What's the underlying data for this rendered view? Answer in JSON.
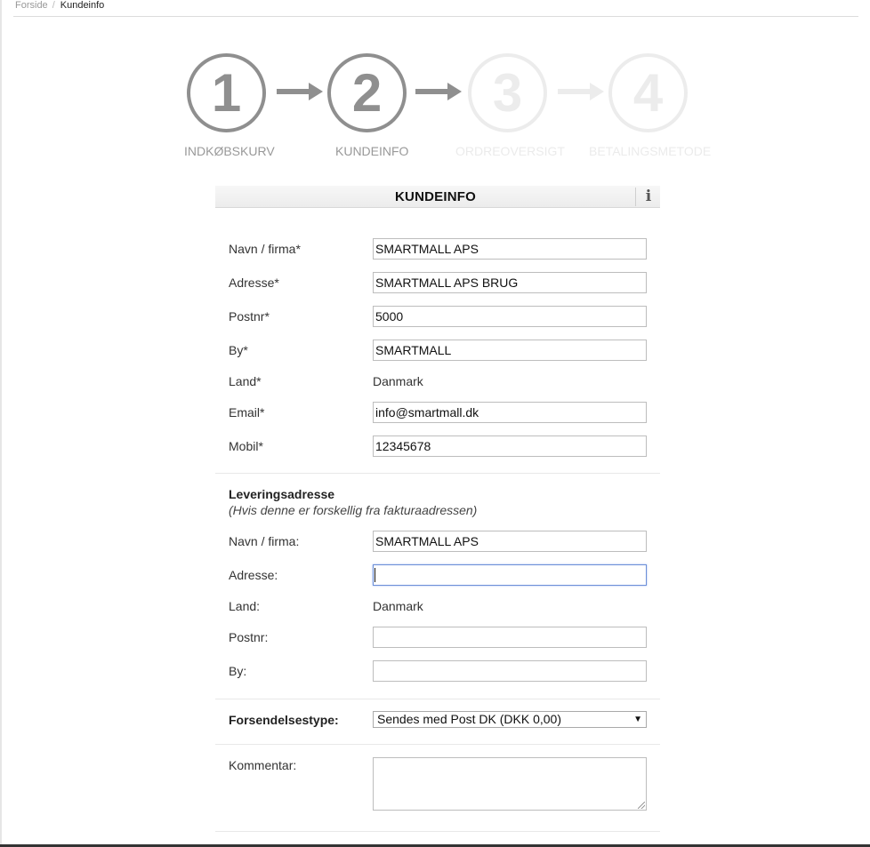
{
  "breadcrumb": {
    "home": "Forside",
    "separator": "/",
    "current": "Kundeinfo"
  },
  "steps": [
    {
      "number": "1",
      "label": "INDKØBSKURV",
      "state": "done"
    },
    {
      "number": "2",
      "label": "KUNDEINFO",
      "state": "active"
    },
    {
      "number": "3",
      "label": "ORDREOVERSIGT",
      "state": "inactive"
    },
    {
      "number": "4",
      "label": "BETALINGSMETODE",
      "state": "inactive"
    }
  ],
  "panel": {
    "title": "KUNDEINFO",
    "info_icon": "info-icon"
  },
  "customer": {
    "name_label": "Navn / firma*",
    "name_value": "SMARTMALL APS",
    "address_label": "Adresse*",
    "address_value": "SMARTMALL APS BRUG",
    "zip_label": "Postnr*",
    "zip_value": "5000",
    "city_label": "By*",
    "city_value": "SMARTMALL",
    "country_label": "Land*",
    "country_value": "Danmark",
    "email_label": "Email*",
    "email_value": "info@smartmall.dk",
    "mobile_label": "Mobil*",
    "mobile_value": "12345678"
  },
  "delivery": {
    "heading": "Leveringsadresse",
    "note": "(Hvis denne er forskellig fra fakturaadressen)",
    "name_label": "Navn / firma:",
    "name_value": "SMARTMALL APS",
    "address_label": "Adresse:",
    "address_value": "",
    "country_label": "Land:",
    "country_value": "Danmark",
    "zip_label": "Postnr:",
    "zip_value": "",
    "city_label": "By:",
    "city_value": ""
  },
  "shipping": {
    "label": "Forsendelsestype:",
    "selected": "Sendes med Post DK (DKK 0,00)"
  },
  "comment": {
    "label": "Kommentar:",
    "value": ""
  },
  "colors": {
    "step_active": "#8f8f8f",
    "step_inactive": "#ececec",
    "focus_border": "#6c8fd8"
  }
}
